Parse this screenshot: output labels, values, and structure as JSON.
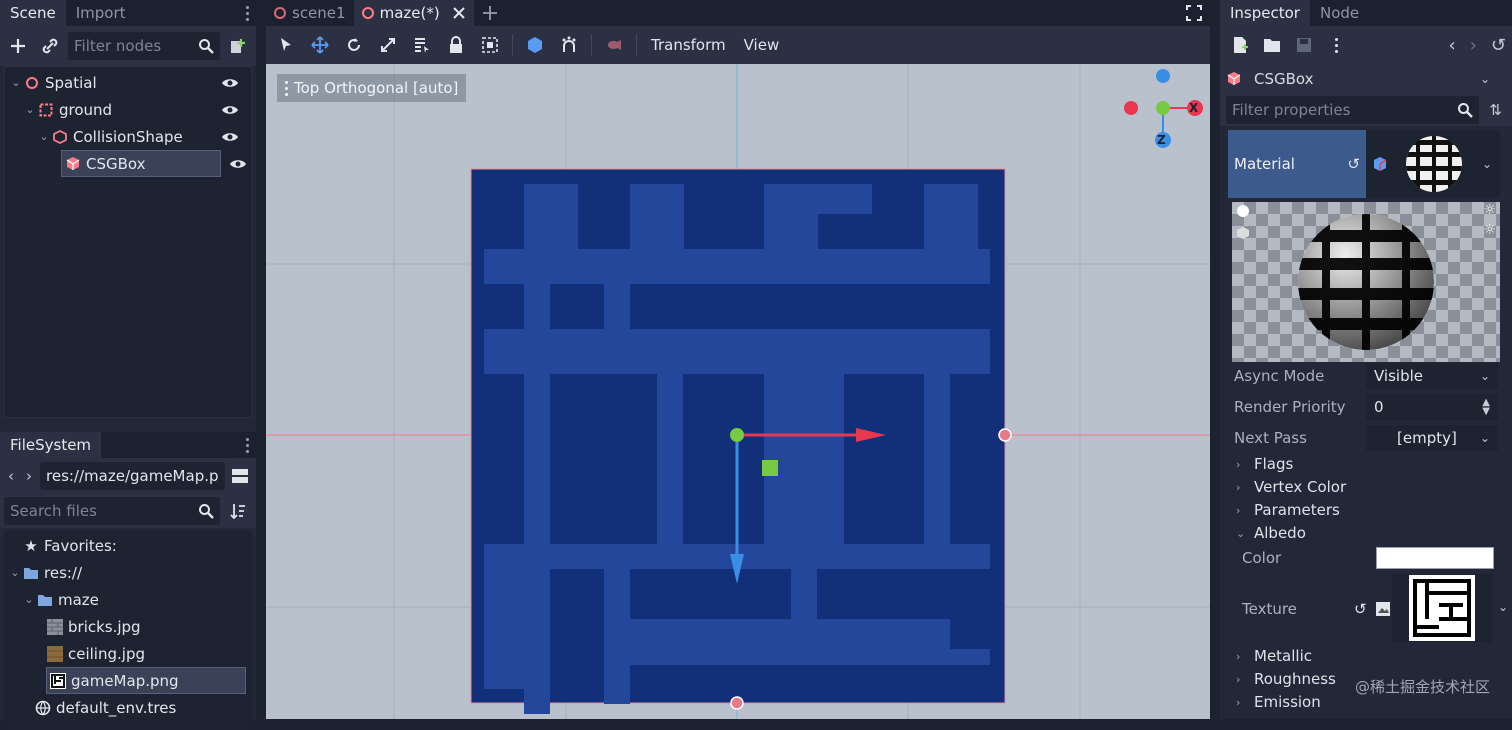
{
  "scene_dock": {
    "tabs": [
      "Scene",
      "Import"
    ],
    "filter_placeholder": "Filter nodes",
    "tree": [
      "Spatial",
      "ground",
      "CollisionShape",
      "CSGBox"
    ]
  },
  "filesystem": {
    "tab": "FileSystem",
    "path": "res://maze/gameMap.p",
    "search_placeholder": "Search files",
    "items": [
      "Favorites:",
      "res://",
      "maze",
      "bricks.jpg",
      "ceiling.jpg",
      "gameMap.png",
      "default_env.tres"
    ]
  },
  "editor": {
    "tabs": [
      "scene1",
      "maze(*)"
    ],
    "menus": [
      "Transform",
      "View"
    ],
    "viewport_label": "Top Orthogonal [auto]",
    "gizmo_labels": {
      "x": "X",
      "z": "Z"
    }
  },
  "inspector": {
    "tabs": [
      "Inspector",
      "Node"
    ],
    "node_name": "CSGBox",
    "filter_placeholder": "Filter properties",
    "material_label": "Material",
    "props": [
      {
        "label": "Async Mode",
        "value": "Visible"
      },
      {
        "label": "Render Priority",
        "value": "0"
      },
      {
        "label": "Next Pass",
        "value": "[empty]"
      }
    ],
    "sections_top": [
      "Flags",
      "Vertex Color",
      "Parameters",
      "Albedo"
    ],
    "albedo_color_label": "Color",
    "albedo_color_value": "#ffffff",
    "texture_label": "Texture",
    "sections_bottom": [
      "Metallic",
      "Roughness",
      "Emission"
    ]
  },
  "watermark": "@稀土掘金技术社区",
  "colors": {
    "accent": "#4a78c8",
    "x_axis": "#e8374f",
    "y_axis": "#7ac943",
    "z_axis": "#3a8ee6",
    "maze_dark": "#12307a",
    "maze_light": "#25479a"
  }
}
